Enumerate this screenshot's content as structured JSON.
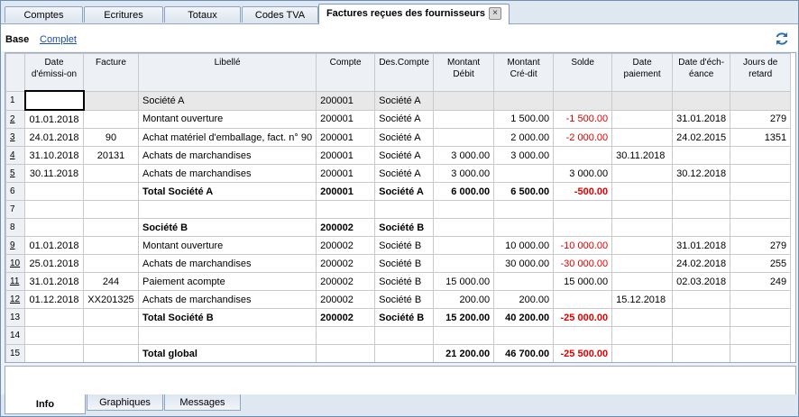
{
  "tabs": [
    {
      "label": "Comptes"
    },
    {
      "label": "Ecritures"
    },
    {
      "label": "Totaux"
    },
    {
      "label": "Codes TVA"
    },
    {
      "label": "Factures reçues des fournisseurs"
    }
  ],
  "active_tab_close": "×",
  "views": {
    "base": "Base",
    "complet": "Complet"
  },
  "columns": [
    "Date d'émissi-on",
    "Facture",
    "Libellé",
    "Compte",
    "Des.Compte",
    "Montant Débit",
    "Montant Cré-dit",
    "Solde",
    "Date paiement",
    "Date d'éch-éance",
    "Jours de retard"
  ],
  "rows": [
    {
      "n": "1",
      "link": false,
      "style": "grey",
      "date": "",
      "facture": "",
      "libelle": "Société A",
      "compte": "200001",
      "des": "Société A",
      "debit": "",
      "credit": "",
      "solde": "",
      "paiement": "",
      "echeance": "",
      "jours": ""
    },
    {
      "n": "2",
      "link": true,
      "style": "",
      "date": "01.01.2018",
      "facture": "",
      "libelle": "Montant ouverture",
      "compte": "200001",
      "des": "Société A",
      "debit": "",
      "credit": "1 500.00",
      "solde": "-1 500.00",
      "paiement": "",
      "echeance": "31.01.2018",
      "jours": "279"
    },
    {
      "n": "3",
      "link": true,
      "style": "",
      "date": "24.01.2018",
      "facture": "90",
      "libelle": "Achat matériel d'emballage, fact. n° 90",
      "compte": "200001",
      "des": "Société A",
      "debit": "",
      "credit": "2 000.00",
      "solde": "-2 000.00",
      "paiement": "",
      "echeance": "24.02.2015",
      "jours": "1351"
    },
    {
      "n": "4",
      "link": true,
      "style": "",
      "date": "31.10.2018",
      "facture": "20131",
      "libelle": "Achats de marchandises",
      "compte": "200001",
      "des": "Société A",
      "debit": "3 000.00",
      "credit": "3 000.00",
      "solde": "",
      "paiement": "30.11.2018",
      "echeance": "",
      "jours": ""
    },
    {
      "n": "5",
      "link": true,
      "style": "",
      "date": "30.11.2018",
      "facture": "",
      "libelle": "Achats de marchandises",
      "compte": "200001",
      "des": "Société A",
      "debit": "3 000.00",
      "credit": "",
      "solde": "3 000.00",
      "paiement": "",
      "echeance": "30.12.2018",
      "jours": ""
    },
    {
      "n": "6",
      "link": false,
      "style": "bold",
      "date": "",
      "facture": "",
      "libelle": "Total Société A",
      "compte": "200001",
      "des": "Société A",
      "debit": "6 000.00",
      "credit": "6 500.00",
      "solde": "-500.00",
      "paiement": "",
      "echeance": "",
      "jours": ""
    },
    {
      "n": "7",
      "link": false,
      "style": "",
      "date": "",
      "facture": "",
      "libelle": "",
      "compte": "",
      "des": "",
      "debit": "",
      "credit": "",
      "solde": "",
      "paiement": "",
      "echeance": "",
      "jours": ""
    },
    {
      "n": "8",
      "link": false,
      "style": "bold",
      "date": "",
      "facture": "",
      "libelle": "Société B",
      "compte": "200002",
      "des": "Société B",
      "debit": "",
      "credit": "",
      "solde": "",
      "paiement": "",
      "echeance": "",
      "jours": ""
    },
    {
      "n": "9",
      "link": true,
      "style": "",
      "date": "01.01.2018",
      "facture": "",
      "libelle": "Montant ouverture",
      "compte": "200002",
      "des": "Société B",
      "debit": "",
      "credit": "10 000.00",
      "solde": "-10 000.00",
      "paiement": "",
      "echeance": "31.01.2018",
      "jours": "279"
    },
    {
      "n": "10",
      "link": true,
      "style": "",
      "date": "25.01.2018",
      "facture": "",
      "libelle": "Achats de marchandises",
      "compte": "200002",
      "des": "Société B",
      "debit": "",
      "credit": "30 000.00",
      "solde": "-30 000.00",
      "paiement": "",
      "echeance": "24.02.2018",
      "jours": "255"
    },
    {
      "n": "11",
      "link": true,
      "style": "",
      "date": "31.01.2018",
      "facture": "244",
      "libelle": "Paiement acompte",
      "compte": "200002",
      "des": "Société B",
      "debit": "15 000.00",
      "credit": "",
      "solde": "15 000.00",
      "paiement": "",
      "echeance": "02.03.2018",
      "jours": "249"
    },
    {
      "n": "12",
      "link": true,
      "style": "",
      "date": "01.12.2018",
      "facture": "XX201325",
      "libelle": "Achats de marchandises",
      "compte": "200002",
      "des": "Société B",
      "debit": "200.00",
      "credit": "200.00",
      "solde": "",
      "paiement": "15.12.2018",
      "echeance": "",
      "jours": ""
    },
    {
      "n": "13",
      "link": false,
      "style": "bold",
      "date": "",
      "facture": "",
      "libelle": "Total Société B",
      "compte": "200002",
      "des": "Société B",
      "debit": "15 200.00",
      "credit": "40 200.00",
      "solde": "-25 000.00",
      "paiement": "",
      "echeance": "",
      "jours": ""
    },
    {
      "n": "14",
      "link": false,
      "style": "",
      "date": "",
      "facture": "",
      "libelle": "",
      "compte": "",
      "des": "",
      "debit": "",
      "credit": "",
      "solde": "",
      "paiement": "",
      "echeance": "",
      "jours": ""
    },
    {
      "n": "15",
      "link": false,
      "style": "bold",
      "date": "",
      "facture": "",
      "libelle": "Total global",
      "compte": "",
      "des": "",
      "debit": "21 200.00",
      "credit": "46 700.00",
      "solde": "-25 500.00",
      "paiement": "",
      "echeance": "",
      "jours": ""
    }
  ],
  "bottom_tabs": [
    {
      "label": "Info"
    },
    {
      "label": "Graphiques"
    },
    {
      "label": "Messages"
    }
  ],
  "colors": {
    "negative": "#e00000",
    "link": "#1a4fb0",
    "header_bg": "#edf1f6"
  },
  "icons": {
    "refresh": "refresh-icon",
    "close": "close-icon"
  }
}
